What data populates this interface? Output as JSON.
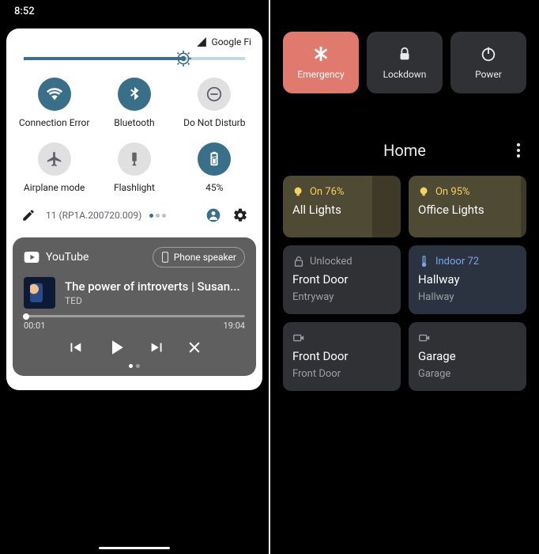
{
  "left": {
    "clock": "8:52",
    "carrier": "Google Fi",
    "tiles": [
      {
        "label": "Connection Error",
        "icon": "wifi",
        "state": "on"
      },
      {
        "label": "Bluetooth",
        "icon": "bt",
        "state": "on"
      },
      {
        "label": "Do Not Disturb",
        "icon": "dnd",
        "state": "off"
      },
      {
        "label": "Airplane mode",
        "icon": "plane",
        "state": "off"
      },
      {
        "label": "Flashlight",
        "icon": "flash",
        "state": "off"
      },
      {
        "label": "45%",
        "icon": "batt",
        "state": "on"
      }
    ],
    "build": "11 (RP1A.200720.009)",
    "media": {
      "app": "YouTube",
      "output": "Phone speaker",
      "title": "The power of introverts | Susan...",
      "subtitle": "TED",
      "elapsed": "00:01",
      "total": "19:04"
    }
  },
  "right": {
    "power": [
      {
        "label": "Emergency",
        "icon": "asterisk",
        "kind": "emergency"
      },
      {
        "label": "Lockdown",
        "icon": "lock",
        "kind": "normal"
      },
      {
        "label": "Power",
        "icon": "power",
        "kind": "normal"
      }
    ],
    "title": "Home",
    "devices": [
      {
        "type": "light",
        "status": "On 76%",
        "name": "All Lights",
        "zone": "",
        "fill": 76
      },
      {
        "type": "light",
        "status": "On 95%",
        "name": "Office Lights",
        "zone": "",
        "fill": 95
      },
      {
        "type": "lock",
        "status": "Unlocked",
        "name": "Front Door",
        "zone": "Entryway"
      },
      {
        "type": "therm",
        "status": "Indoor 72",
        "name": "Hallway",
        "zone": "Hallway"
      },
      {
        "type": "cam",
        "status": "",
        "name": "Front Door",
        "zone": "Front Door"
      },
      {
        "type": "cam",
        "status": "",
        "name": "Garage",
        "zone": "Garage"
      }
    ]
  }
}
